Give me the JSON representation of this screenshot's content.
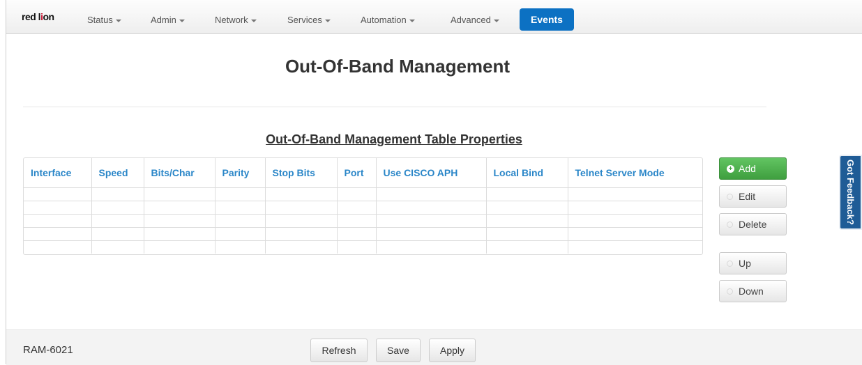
{
  "nav": {
    "brand_a": "red l",
    "brand_b": "i",
    "brand_c": "on",
    "items": [
      {
        "label": "Status"
      },
      {
        "label": "Admin"
      },
      {
        "label": "Network"
      },
      {
        "label": "Services"
      },
      {
        "label": "Automation"
      },
      {
        "label": "Advanced"
      }
    ],
    "active": "Events",
    "accent_color": "#0c71c3"
  },
  "page": {
    "title": "Out-Of-Band Management",
    "section_title": "Out-Of-Band Management Table Properties"
  },
  "table": {
    "columns": [
      "Interface",
      "Speed",
      "Bits/Char",
      "Parity",
      "Stop Bits",
      "Port",
      "Use CISCO APH",
      "Local Bind",
      "Telnet Server Mode"
    ],
    "rows": [
      [],
      [],
      [],
      [],
      []
    ]
  },
  "actions": {
    "add": "Add",
    "edit": "Edit",
    "delete": "Delete",
    "up": "Up",
    "down": "Down",
    "add_color": "#4cae4c"
  },
  "feedback": {
    "label": "Got Feedback?"
  },
  "footer": {
    "model": "RAM-6021",
    "refresh": "Refresh",
    "save": "Save",
    "apply": "Apply"
  }
}
